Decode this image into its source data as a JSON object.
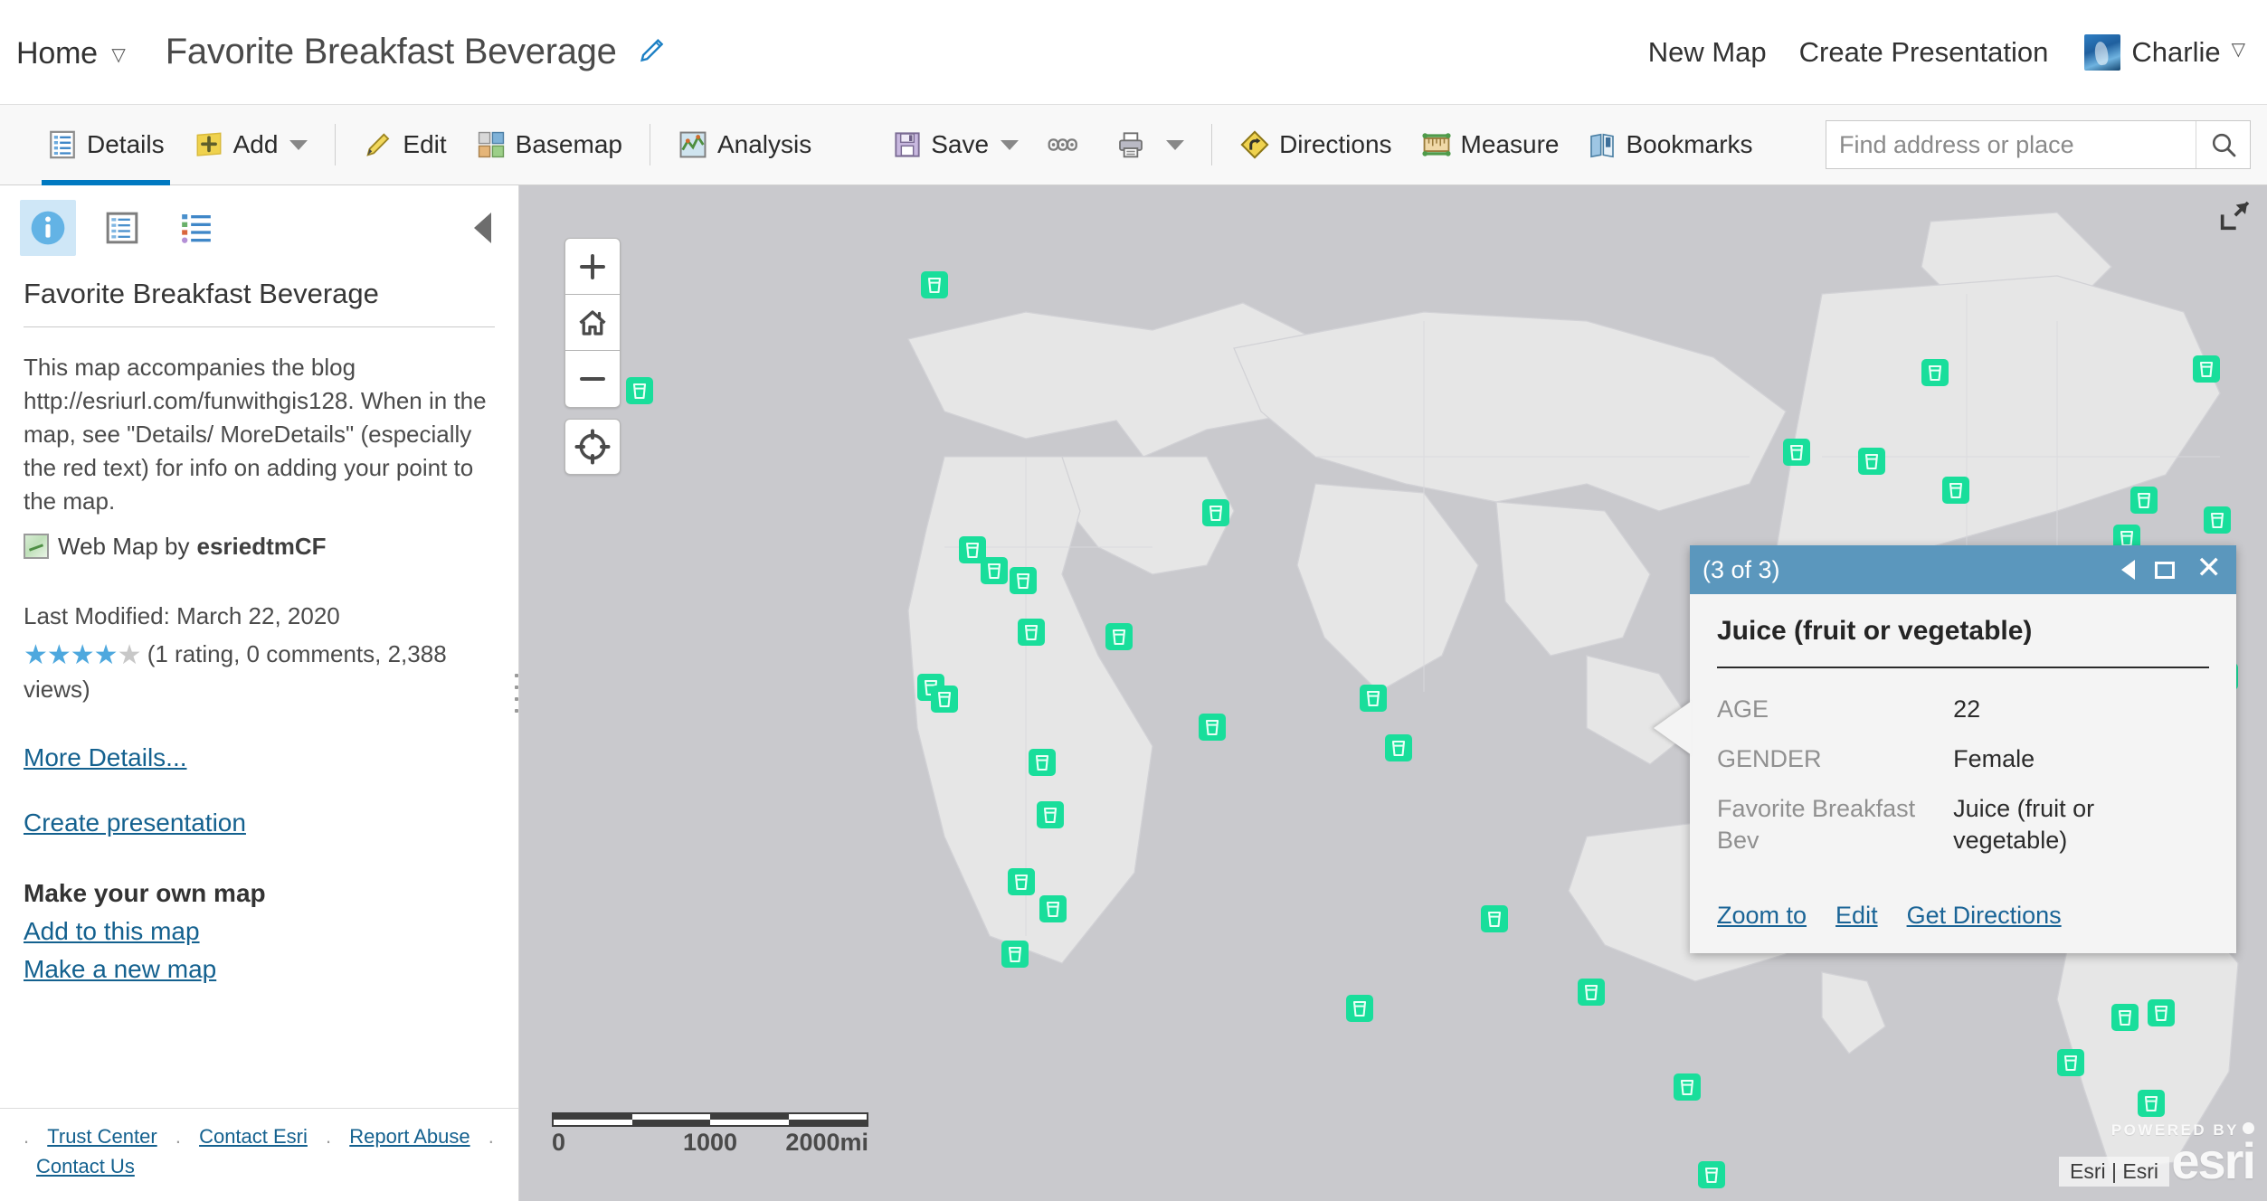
{
  "header": {
    "home_label": "Home",
    "map_title": "Favorite Breakfast Beverage",
    "edit_title_icon": "pencil-icon",
    "new_map_label": "New Map",
    "create_presentation_label": "Create Presentation",
    "user_name": "Charlie"
  },
  "toolbar": {
    "details_label": "Details",
    "add_label": "Add",
    "edit_label": "Edit",
    "basemap_label": "Basemap",
    "analysis_label": "Analysis",
    "save_label": "Save",
    "share_label": "Share",
    "print_label": "",
    "directions_label": "Directions",
    "measure_label": "Measure",
    "bookmarks_label": "Bookmarks",
    "search_placeholder": "Find address or place",
    "search_value": "",
    "active_tab": "Details",
    "accent_color": "#0079c1"
  },
  "sidebar": {
    "tabs": [
      {
        "name": "about",
        "selected": true
      },
      {
        "name": "contents",
        "selected": false
      },
      {
        "name": "legend",
        "selected": false
      }
    ],
    "panel_title": "Favorite Breakfast Beverage",
    "description": "This map accompanies the blog http://esriurl.com/funwithgis128. When in the map, see \"Details/ MoreDetails\" (especially the red text) for info on adding your point to the map.",
    "byline_prefix": "Web Map by",
    "byline_author": "esriedtmCF",
    "last_modified": "Last Modified: March 22, 2020",
    "rating_filled": 4,
    "rating_total": 5,
    "rating_summary": "(1 rating, 0 comments, 2,388 views)",
    "more_details_label": "More Details...",
    "create_presentation_label": "Create presentation",
    "make_own_map_heading": "Make your own map",
    "add_to_this_map_label": "Add to this map",
    "make_new_map_label": "Make a new map",
    "footer_links": [
      "Trust Center",
      "Contact Esri",
      "Report Abuse",
      "Contact Us"
    ]
  },
  "map": {
    "zoom_in_label": "+",
    "zoom_out_label": "−",
    "home_label": "home-icon",
    "locate_label": "locate-icon",
    "expand_label": "expand-icon",
    "scalebar": {
      "start": "0",
      "mid": "1000",
      "end": "2000mi"
    },
    "attribution": "Esri | Esri",
    "logo_powered_by": "POWERED BY",
    "logo_name": "esri",
    "marker_color": "#19de9b",
    "selected_marker_outline": "#27bdf0",
    "basemap_land_color": "#e6e6e6",
    "basemap_ocean_color": "#c9c9cd"
  },
  "popup": {
    "counter": "(3 of 3)",
    "title": "Juice (fruit or vegetable)",
    "header_color": "#5b97bd",
    "attributes": [
      {
        "key": "AGE",
        "value": "22"
      },
      {
        "key": "GENDER",
        "value": "Female"
      },
      {
        "key": "Favorite Breakfast Bev",
        "value": "Juice (fruit or vegetable)"
      }
    ],
    "actions": [
      "Zoom to",
      "Edit",
      "Get Directions"
    ]
  }
}
